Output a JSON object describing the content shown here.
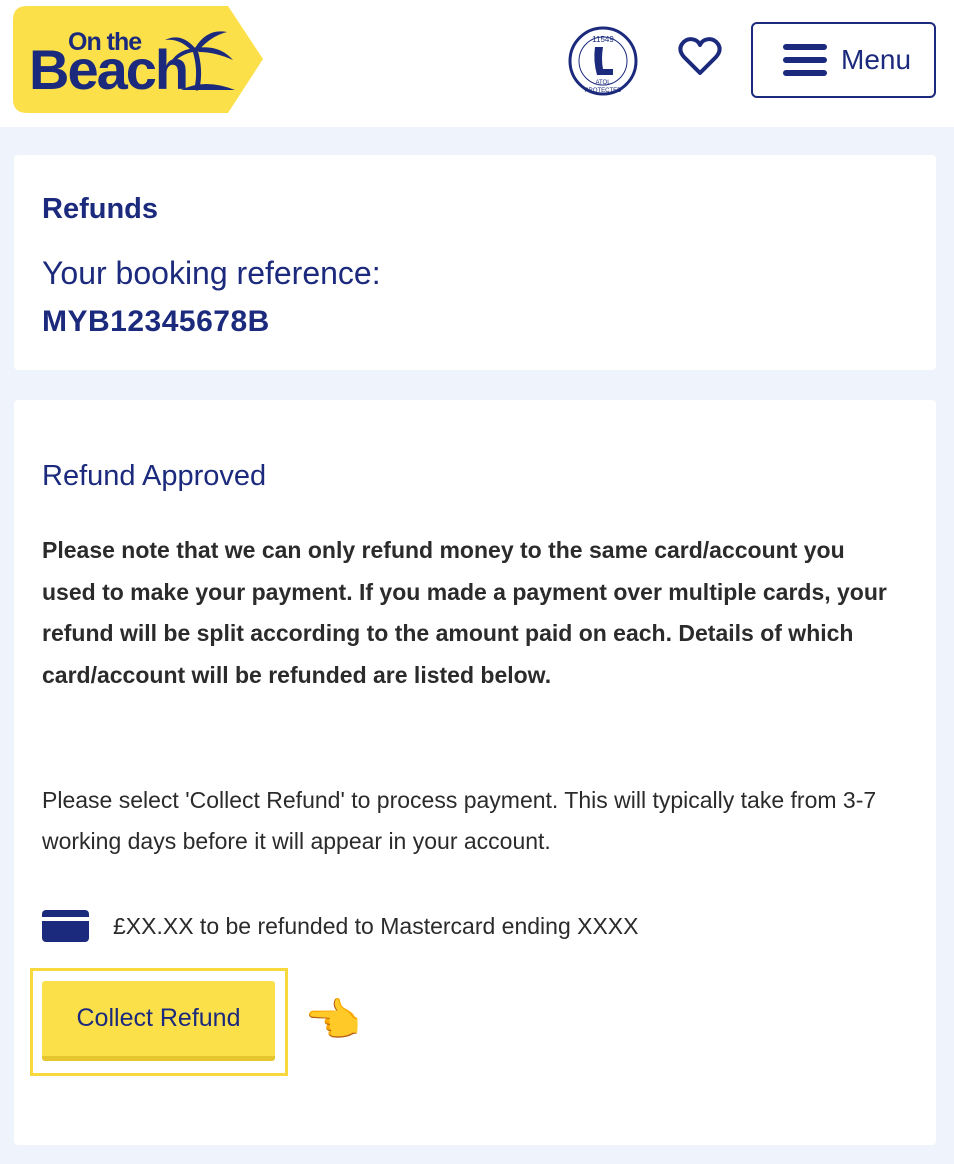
{
  "header": {
    "logo": {
      "line1": "On the",
      "line2": "Beach"
    },
    "atol": {
      "number": "11549",
      "text": "ATOL",
      "protected": "PROTECTED"
    },
    "icons": {
      "favourites": "heart-icon",
      "menu": "hamburger-icon"
    },
    "menu_label": "Menu"
  },
  "booking": {
    "title": "Refunds",
    "reference_label": "Your booking reference:",
    "reference": "MYB12345678B"
  },
  "refund": {
    "status": "Refund Approved",
    "notice": "Please note that we can only refund money to the same card/account you used to make your payment. If you made a payment over multiple cards, your refund will be split according to the amount paid on each. Details of which card/account will be refunded are listed below.",
    "instructions": "Please select 'Collect Refund' to process payment. This will typically take from 3-7 working days before it will appear in your account.",
    "amount_line": "£XX.XX to be refunded to Mastercard ending XXXX",
    "button_label": "Collect Refund",
    "pointer_emoji": "👈"
  },
  "colors": {
    "brand_navy": "#1b2a7c",
    "brand_yellow": "#fbe04a",
    "page_background": "#eef3fc"
  }
}
